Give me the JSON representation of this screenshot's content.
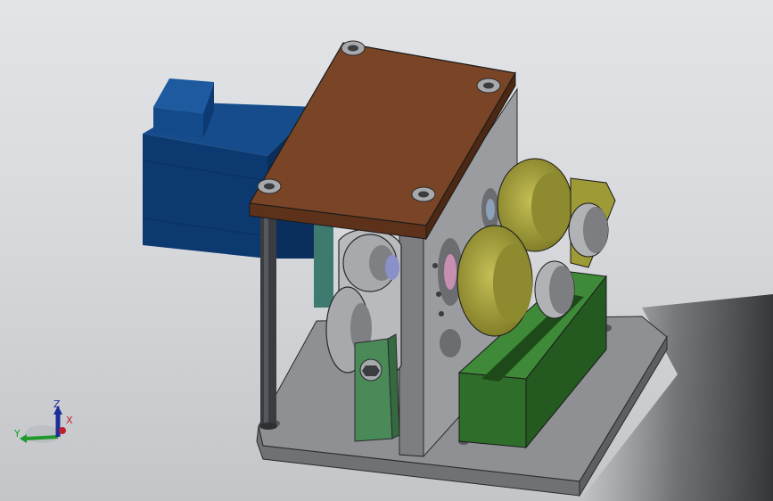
{
  "colors": {
    "background_top": "#e2e4e8",
    "background_bottom": "#c3c5c9",
    "base_plate": "#8e9094",
    "frame_gray": "#9a9ca0",
    "top_plate": "#7a4526",
    "motor_blue": "#0d3e78",
    "roller_yellow": "#a9a43a",
    "green_block": "#2f6e2a",
    "axis_x": "#c0202a",
    "axis_y": "#1f9a2a",
    "axis_z": "#1c2d9a"
  },
  "triad": {
    "x_label": "X",
    "y_label": "Y",
    "z_label": "Z"
  }
}
